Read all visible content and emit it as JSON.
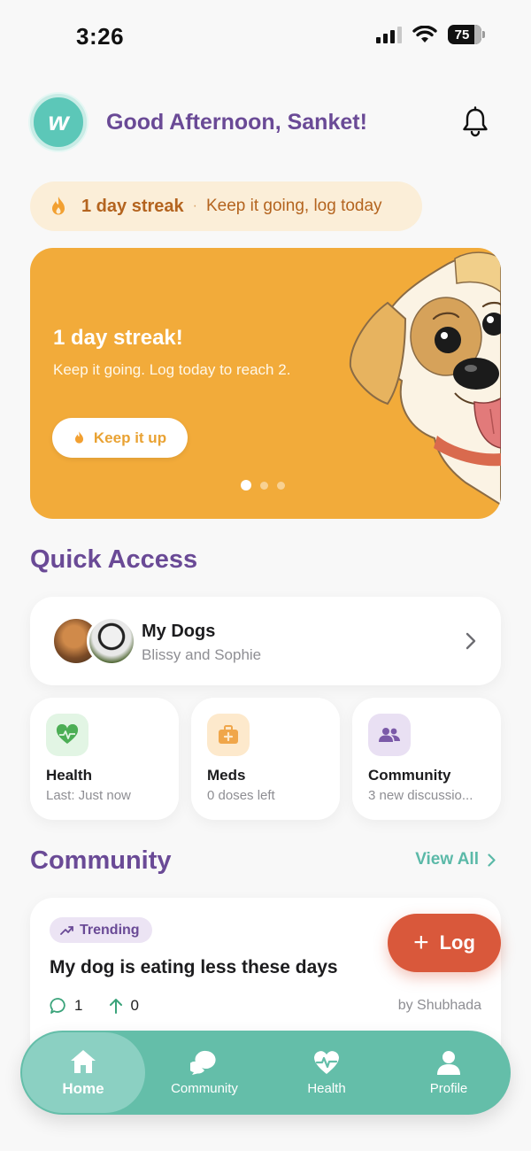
{
  "status_bar": {
    "time": "3:26",
    "battery": "75"
  },
  "header": {
    "logo_letter": "w",
    "greeting": "Good Afternoon, Sanket!"
  },
  "streak_pill": {
    "strong": "1 day streak",
    "separator": "·",
    "text": "Keep it going, log today"
  },
  "banner": {
    "title": "1 day streak!",
    "text": "Keep it going. Log today to reach 2.",
    "button": "Keep it up",
    "page_count": 3,
    "active_page": 0,
    "colors": {
      "background": "#f2ab3a"
    }
  },
  "quick_access": {
    "title": "Quick Access",
    "dogs": {
      "title": "My Dogs",
      "subtitle": "Blissy and Sophie"
    },
    "tiles": [
      {
        "title": "Health",
        "subtitle": "Last: Just now",
        "icon": "heart-pulse-icon",
        "color": "#5cb85c"
      },
      {
        "title": "Meds",
        "subtitle": "0 doses left",
        "icon": "medkit-icon",
        "color": "#f0a64a"
      },
      {
        "title": "Community",
        "subtitle": "3 new discussio...",
        "icon": "people-icon",
        "color": "#7b5aa8"
      }
    ]
  },
  "community": {
    "title": "Community",
    "view_all": "View All",
    "post": {
      "tag": "Trending",
      "title": "My dog is eating less these days",
      "comments": "1",
      "upvotes": "0",
      "author": "by Shubhada"
    }
  },
  "fab": {
    "plus": "+",
    "label": "Log",
    "color": "#d9583b"
  },
  "tabs": [
    {
      "label": "Home",
      "icon": "home-icon",
      "active": true
    },
    {
      "label": "Community",
      "icon": "chat-bubbles-icon",
      "active": false
    },
    {
      "label": "Health",
      "icon": "heart-pulse-icon",
      "active": false
    },
    {
      "label": "Profile",
      "icon": "person-icon",
      "active": false
    }
  ],
  "colors": {
    "brand_purple": "#6a4a96",
    "brand_teal": "#64bea9",
    "accent_orange": "#d9583b"
  }
}
